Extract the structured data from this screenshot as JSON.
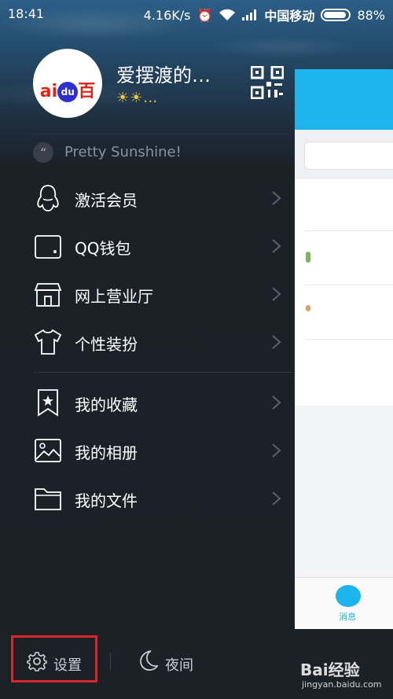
{
  "status_bar": {
    "time": "18:41",
    "speed": "4.16K/s",
    "carrier": "中国移动",
    "battery": "88%"
  },
  "profile": {
    "nickname": "爱摆渡的…",
    "avatar_logo": "Bai百",
    "badges": "☀☀…",
    "signature": "Pretty Sunshine!"
  },
  "menu": {
    "group1": [
      {
        "label": "激活会员",
        "icon": "penguin-icon"
      },
      {
        "label": "QQ钱包",
        "icon": "wallet-icon"
      },
      {
        "label": "网上营业厅",
        "icon": "store-icon"
      },
      {
        "label": "个性装扮",
        "icon": "tshirt-icon"
      }
    ],
    "group2": [
      {
        "label": "我的收藏",
        "icon": "bookmark-icon"
      },
      {
        "label": "我的相册",
        "icon": "photo-icon"
      },
      {
        "label": "我的文件",
        "icon": "folder-icon"
      }
    ]
  },
  "bottom": {
    "settings_label": "设置",
    "night_label": "夜间",
    "watermark": "Bai经验",
    "watermark_url": "jingyan.baidu.com"
  },
  "background_app": {
    "tab_label": "消息"
  },
  "colors": {
    "drawer_bg": "#1c2027",
    "accent_blue": "#1db3ec",
    "highlight_red": "#d9252c"
  }
}
